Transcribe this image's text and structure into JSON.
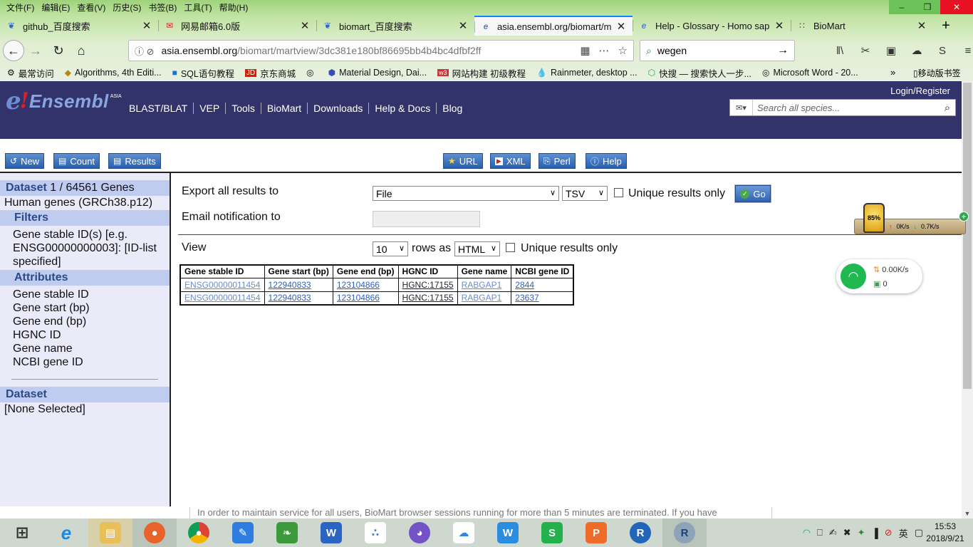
{
  "browser": {
    "menu": [
      "文件(F)",
      "编辑(E)",
      "查看(V)",
      "历史(S)",
      "书签(B)",
      "工具(T)",
      "帮助(H)"
    ],
    "tabs": [
      {
        "label": "github_百度搜索",
        "icon": "paw-icon"
      },
      {
        "label": "网易邮箱6.0版",
        "icon": "mail-icon"
      },
      {
        "label": "biomart_百度搜索",
        "icon": "paw-icon"
      },
      {
        "label": "asia.ensembl.org/biomart/m",
        "icon": "ensembl-icon",
        "active": true
      },
      {
        "label": "Help - Glossary - Homo sap",
        "icon": "ensembl-icon"
      },
      {
        "label": "BioMart",
        "icon": "grid-icon"
      }
    ],
    "url_host": "asia.ensembl.org",
    "url_path": "/biomart/martview/3dc381e180bf86695bb4b4bc4dfbf2ff",
    "search_value": "wegen",
    "bookmarks": [
      "最常访问",
      "Algorithms, 4th Editi...",
      "SQL语句教程",
      "京东商城",
      "",
      "Material Design, Dai...",
      "网站构建 初级教程",
      "Rainmeter, desktop ...",
      "快搜 — 搜索快人一步...",
      "Microsoft Word - 20..."
    ],
    "bookmarks_more": "»",
    "bookmarks_mobile": "移动版书签"
  },
  "ensembl": {
    "logo_name": "Ensembl",
    "logo_region": "ASIA",
    "nav": [
      "BLAST/BLAT",
      "VEP",
      "Tools",
      "BioMart",
      "Downloads",
      "Help & Docs",
      "Blog"
    ],
    "login": "Login/Register",
    "search_placeholder": "Search all species..."
  },
  "toolbar": {
    "new": "New",
    "count": "Count",
    "results": "Results",
    "url": "URL",
    "xml": "XML",
    "perl": "Perl",
    "help": "Help"
  },
  "sidebar": {
    "dataset_heading": "Dataset",
    "dataset_count": "1 / 64561 Genes",
    "dataset_name": "Human genes (GRCh38.p12)",
    "filters_heading": "Filters",
    "filter_text": "Gene stable ID(s) [e.g. ENSG00000000003]: [ID-list specified]",
    "attributes_heading": "Attributes",
    "attributes": [
      "Gene stable ID",
      "Gene start (bp)",
      "Gene end (bp)",
      "HGNC ID",
      "Gene name",
      "NCBI gene ID"
    ],
    "dataset2_heading": "Dataset",
    "dataset2_value": "[None Selected]"
  },
  "export": {
    "label": "Export  all results to",
    "destination": "File",
    "format": "TSV",
    "unique_label": "Unique results only",
    "go": "Go",
    "email_label": "Email notification to",
    "view_label": "View",
    "rows_value": "10",
    "rows_as": "rows as",
    "view_format": "HTML",
    "unique_label2": "Unique results only"
  },
  "results": {
    "headers": [
      "Gene stable ID",
      "Gene start (bp)",
      "Gene end (bp)",
      "HGNC ID",
      "Gene name",
      "NCBI gene ID"
    ],
    "rows": [
      [
        "ENSG00000011454",
        "122940833",
        "123104866",
        "HGNC:17155",
        "RABGAP1",
        "2844"
      ],
      [
        "ENSG00000011454",
        "122940833",
        "123104866",
        "HGNC:17155",
        "RABGAP1",
        "23637"
      ]
    ]
  },
  "notice": "In order to maintain service for all users, BioMart browser sessions running for more than 5 minutes are terminated. If you have",
  "widgets": {
    "lamp_percent": "85%",
    "lamp_up": "0K/s",
    "lamp_down": "0.7K/s",
    "wifi_speed": "0.00K/s",
    "wifi_count": "0"
  },
  "taskbar": {
    "apps": [
      {
        "name": "start-button",
        "color": "#cfd8cf"
      },
      {
        "name": "ie-app",
        "color": "#1e88e5"
      },
      {
        "name": "explorer-app",
        "color": "#e8c05a"
      },
      {
        "name": "firefox-app",
        "color": "#e8632a"
      },
      {
        "name": "chrome-app",
        "color": "#3a9b45"
      },
      {
        "name": "notes-app",
        "color": "#2f7de1"
      },
      {
        "name": "evernote-app",
        "color": "#3b9b3b"
      },
      {
        "name": "word-app",
        "color": "#2b64c2"
      },
      {
        "name": "baidu-netdisk-app",
        "color": "#3e7fe0"
      },
      {
        "name": "github-app",
        "color": "#7352c7"
      },
      {
        "name": "cloud-app",
        "color": "#2f86e0"
      },
      {
        "name": "wps-writer-app",
        "color": "#2a8de0"
      },
      {
        "name": "wps-sheet-app",
        "color": "#22b14c"
      },
      {
        "name": "wps-ppt-app",
        "color": "#ef6b2a"
      },
      {
        "name": "r-app",
        "color": "#2266bb"
      },
      {
        "name": "rstudio-app",
        "color": "#8fa3b8"
      }
    ],
    "ime": "英",
    "time": "15:53",
    "date": "2018/9/21"
  }
}
